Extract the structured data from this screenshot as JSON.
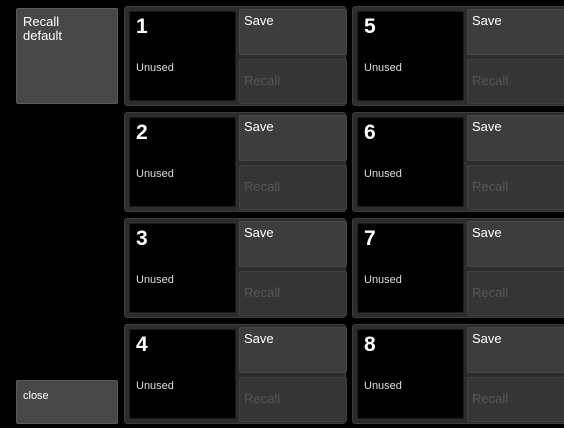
{
  "left_panel": {
    "recall_default_label": "Recall\ndefault",
    "close_label": "close"
  },
  "presets": [
    {
      "number": "1",
      "status": "Unused",
      "save_label": "Save",
      "recall_label": "Recall"
    },
    {
      "number": "2",
      "status": "Unused",
      "save_label": "Save",
      "recall_label": "Recall"
    },
    {
      "number": "3",
      "status": "Unused",
      "save_label": "Save",
      "recall_label": "Recall"
    },
    {
      "number": "4",
      "status": "Unused",
      "save_label": "Save",
      "recall_label": "Recall"
    },
    {
      "number": "5",
      "status": "Unused",
      "save_label": "Save",
      "recall_label": "Recall"
    },
    {
      "number": "6",
      "status": "Unused",
      "save_label": "Save",
      "recall_label": "Recall"
    },
    {
      "number": "7",
      "status": "Unused",
      "save_label": "Save",
      "recall_label": "Recall"
    },
    {
      "number": "8",
      "status": "Unused",
      "save_label": "Save",
      "recall_label": "Recall"
    }
  ],
  "colors": {
    "background": "#000000",
    "button": "#3d3d3d",
    "disabled_text": "#555555",
    "text": "#ffffff"
  }
}
